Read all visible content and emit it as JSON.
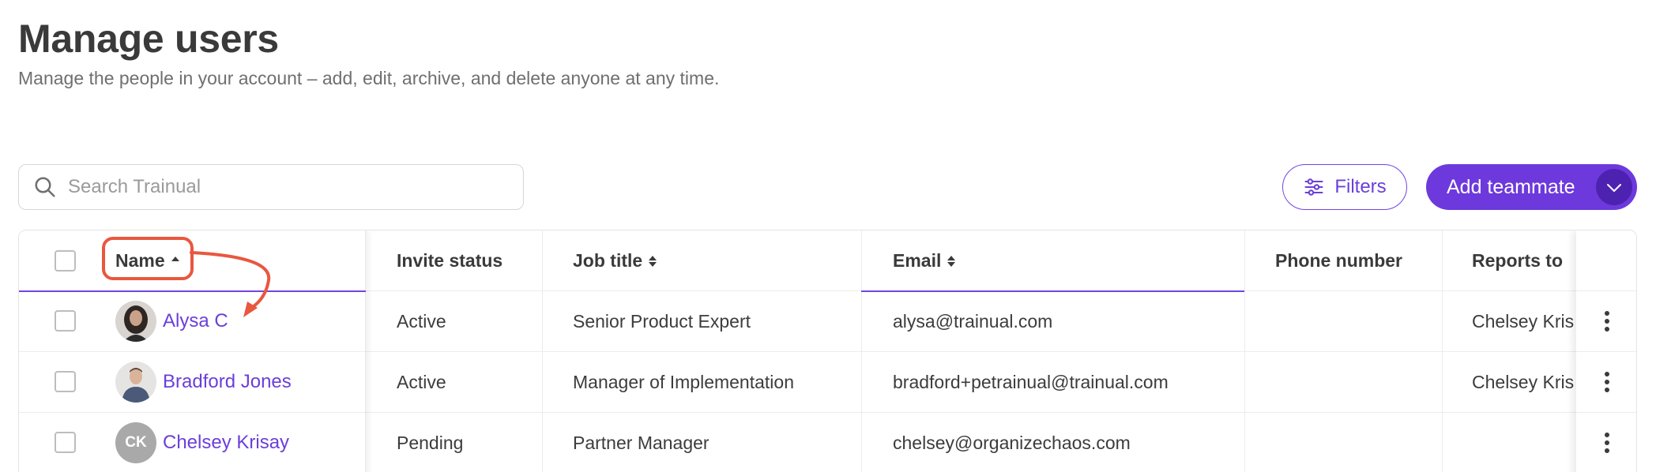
{
  "page": {
    "title": "Manage users",
    "subtitle": "Manage the people in your account – add, edit, archive, and delete anyone at any time."
  },
  "toolbar": {
    "search_placeholder": "Search Trainual",
    "filters_label": "Filters",
    "add_label": "Add teammate"
  },
  "table": {
    "headers": {
      "name": "Name",
      "invite_status": "Invite status",
      "job_title": "Job title",
      "email": "Email",
      "phone_number": "Phone number",
      "reports_to": "Reports to"
    },
    "rows": [
      {
        "name": "Alysa C",
        "invite_status": "Active",
        "job_title": "Senior Product Expert",
        "email": "alysa@trainual.com",
        "phone_number": "",
        "reports_to": "Chelsey Kris",
        "avatar": "photo"
      },
      {
        "name": "Bradford Jones",
        "invite_status": "Active",
        "job_title": "Manager of Implementation",
        "email": "bradford+petrainual@trainual.com",
        "phone_number": "",
        "reports_to": "Chelsey Kris",
        "avatar": "photo"
      },
      {
        "name": "Chelsey Krisay",
        "invite_status": "Pending",
        "job_title": "Partner Manager",
        "email": "chelsey@organizechaos.com",
        "phone_number": "",
        "reports_to": "",
        "avatar": "CK"
      }
    ]
  },
  "colors": {
    "accent": "#6d39dc",
    "accent_dark": "#4e22b0",
    "annotation": "#e9573f"
  },
  "icons": [
    "search-icon",
    "sliders-icon",
    "chevron-down-icon",
    "sort-asc-icon",
    "sort-both-icon",
    "kebab-icon",
    "annotation-arrow"
  ]
}
